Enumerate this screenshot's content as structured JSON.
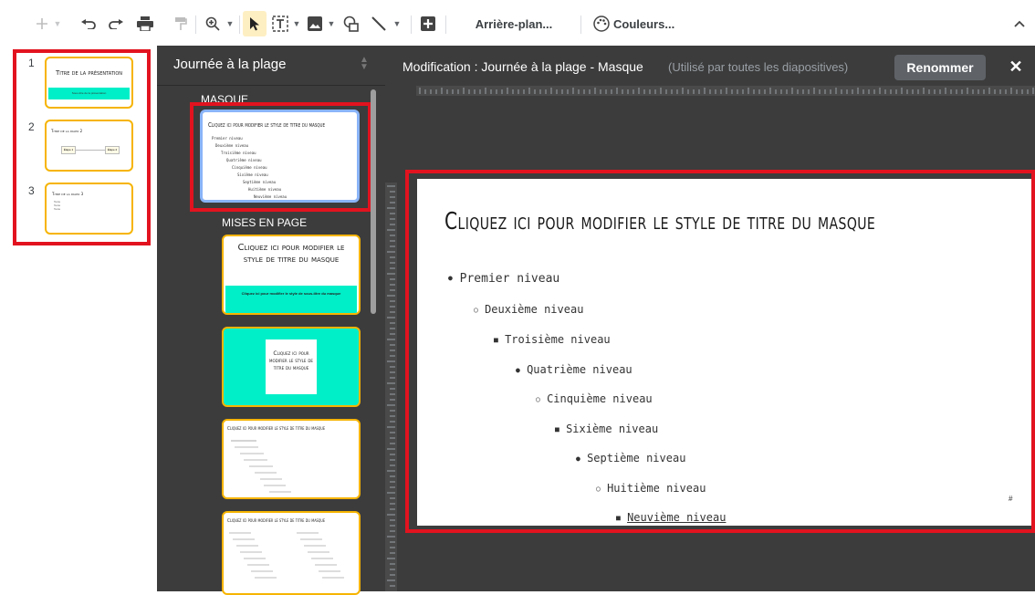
{
  "toolbar": {
    "background_label": "Arrière-plan...",
    "colors_label": "Couleurs..."
  },
  "filmstrip": {
    "slides": [
      {
        "number": "1",
        "title": "Titre de la présentation",
        "subtitle": "Sous-titre de la présentation"
      },
      {
        "number": "2",
        "title": "Titre de la diapo 2",
        "step1": "Étape 1",
        "step2": "Étape 2"
      },
      {
        "number": "3",
        "title": "Titre de la diapo 3",
        "bullets": [
          "Texte",
          "Texte",
          "Texte"
        ]
      }
    ]
  },
  "layout_panel": {
    "theme_name": "Journée à la plage",
    "master_label": "MASQUE",
    "layouts_label": "MISES EN PAGE",
    "layout1_title": "Cliquez ici pour modifier le style de titre du masque",
    "layout1_subtitle": "Cliquez ici pour modifier le style de sous-titre du masque",
    "layout2_title": "Cliquez ici pour modifier le style de titre du masque"
  },
  "editor": {
    "heading": "Modification : Journée à la plage - Masque",
    "heading_note": "(Utilisé par toutes les diapositives)",
    "rename_label": "Renommer",
    "close_label": "✕"
  },
  "slide": {
    "title": "Cliquez ici pour modifier le style de titre du masque",
    "slide_number": "#",
    "levels": [
      {
        "bullet": "●",
        "text": "Premier niveau"
      },
      {
        "bullet": "○",
        "text": "Deuxième niveau"
      },
      {
        "bullet": "■",
        "text": "Troisième niveau"
      },
      {
        "bullet": "●",
        "text": "Quatrième niveau"
      },
      {
        "bullet": "○",
        "text": "Cinquième niveau"
      },
      {
        "bullet": "■",
        "text": "Sixième niveau"
      },
      {
        "bullet": "●",
        "text": "Septième niveau"
      },
      {
        "bullet": "○",
        "text": "Huitième niveau"
      },
      {
        "bullet": "■",
        "text": "Neuvième niveau"
      }
    ]
  },
  "colors": {
    "accent_teal": "#00efc8",
    "thumb_border": "#f6b400",
    "highlight_red": "#e2131f",
    "dark_panel": "#3c3c3c",
    "master_outline": "#8ab4f8"
  }
}
